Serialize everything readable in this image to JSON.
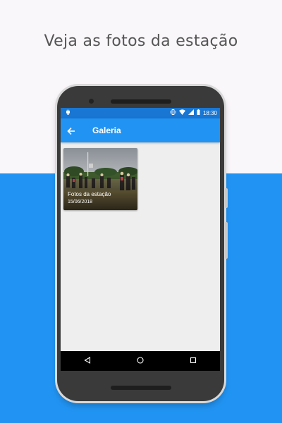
{
  "headline": "Veja as fotos da estação",
  "status_bar": {
    "time": "18:30",
    "icons": [
      "android-notification-icon",
      "vibrate-icon",
      "wifi-icon",
      "signal-icon",
      "battery-icon"
    ]
  },
  "app_bar": {
    "title": "Galeria",
    "back_icon": "arrow-left-icon"
  },
  "gallery": {
    "items": [
      {
        "title": "Fotos da estação",
        "date": "15/06/2018"
      }
    ]
  },
  "nav_bar": [
    "back-triangle-icon",
    "home-circle-icon",
    "recents-square-icon"
  ],
  "colors": {
    "primary": "#2194f3",
    "primary_dark": "#1976d2",
    "background_top": "#faf7fb",
    "screen_bg": "#eeeeee"
  }
}
